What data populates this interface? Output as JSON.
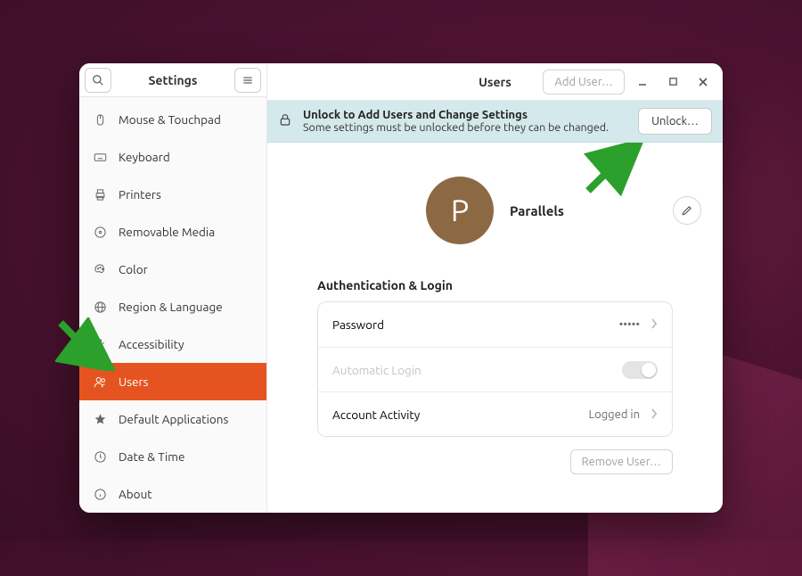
{
  "sidebar": {
    "title": "Settings",
    "items": [
      {
        "label": "Mouse & Touchpad",
        "icon": "mouse"
      },
      {
        "label": "Keyboard",
        "icon": "keyboard"
      },
      {
        "label": "Printers",
        "icon": "printer"
      },
      {
        "label": "Removable Media",
        "icon": "disc"
      },
      {
        "label": "Color",
        "icon": "color"
      },
      {
        "label": "Region & Language",
        "icon": "globe"
      },
      {
        "label": "Accessibility",
        "icon": "person"
      },
      {
        "label": "Users",
        "icon": "users",
        "active": true
      },
      {
        "label": "Default Applications",
        "icon": "star"
      },
      {
        "label": "Date & Time",
        "icon": "clock"
      },
      {
        "label": "About",
        "icon": "info"
      }
    ]
  },
  "header": {
    "title": "Users",
    "add_user_label": "Add User…"
  },
  "banner": {
    "title": "Unlock to Add Users and Change Settings",
    "subtitle": "Some settings must be unlocked before they can be changed.",
    "button": "Unlock…"
  },
  "profile": {
    "initial": "P",
    "name": "Parallels"
  },
  "auth": {
    "section_title": "Authentication & Login",
    "rows": {
      "password": {
        "label": "Password",
        "value": "•••••"
      },
      "auto_login": {
        "label": "Automatic Login"
      },
      "activity": {
        "label": "Account Activity",
        "value": "Logged in"
      }
    }
  },
  "remove_user_label": "Remove User…"
}
